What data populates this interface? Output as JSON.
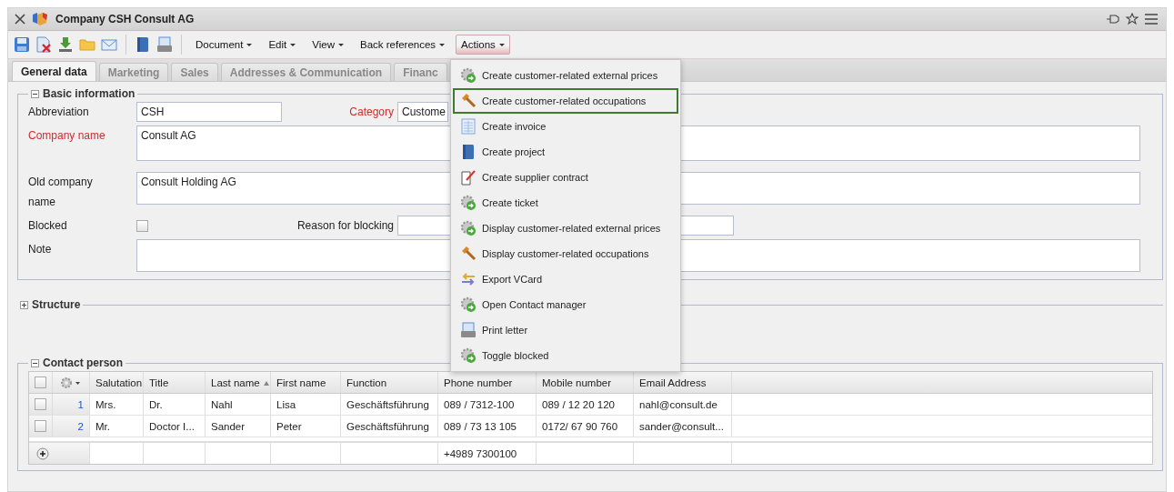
{
  "window": {
    "title": "Company CSH Consult AG"
  },
  "toolbar": {
    "menus": [
      {
        "label": "Document",
        "selected": false
      },
      {
        "label": "Edit",
        "selected": false
      },
      {
        "label": "View",
        "selected": false
      },
      {
        "label": "Back references",
        "selected": false
      },
      {
        "label": "Actions",
        "selected": true
      }
    ]
  },
  "tabs": [
    {
      "label": "General data",
      "selected": true
    },
    {
      "label": "Marketing",
      "selected": false
    },
    {
      "label": "Sales",
      "selected": false
    },
    {
      "label": "Addresses & Communication",
      "selected": false
    },
    {
      "label": "Financ",
      "selected": false
    }
  ],
  "basic_information": {
    "title": "Basic information",
    "expanded": true,
    "abbreviation": {
      "label": "Abbreviation",
      "required": false,
      "value": "CSH"
    },
    "category": {
      "label": "Category",
      "required": true,
      "value": "Custome"
    },
    "company_name": {
      "label": "Company name",
      "required": true,
      "value": "Consult AG"
    },
    "old_company_name": {
      "label": "Old company name",
      "required": false,
      "value": "Consult Holding AG"
    },
    "blocked": {
      "label": "Blocked",
      "checked": false
    },
    "reason_for_blocking": {
      "label": "Reason for blocking"
    },
    "note": {
      "label": "Note",
      "required": false
    }
  },
  "structure": {
    "title": "Structure",
    "expanded": false
  },
  "contact_person": {
    "title": "Contact person",
    "expanded": true,
    "columns": [
      "Salutation",
      "Title",
      "Last name",
      "First name",
      "Function",
      "Phone number",
      "Mobile number",
      "Email Address"
    ],
    "rows": [
      {
        "checked": false,
        "number": "1",
        "cells": [
          "Mrs.",
          "Dr.",
          "Nahl",
          "Lisa",
          "Geschäftsführung",
          "089 / 7312-100",
          "089 / 12 20 120",
          "nahl@consult.de"
        ]
      },
      {
        "checked": false,
        "number": "2",
        "cells": [
          "Mr.",
          "Doctor I...",
          "Sander",
          "Peter",
          "Geschäftsführung",
          "089 / 73 13 105",
          "0172/ 67 90 760",
          "sander@consult..."
        ]
      }
    ],
    "all_checked": false,
    "footer": {
      "phone_number": "+4989 7300100"
    }
  },
  "actions_menu": {
    "items": [
      {
        "label": "Create customer-related external prices",
        "selected": false
      },
      {
        "label": "Create customer-related occupations",
        "selected": true
      },
      {
        "label": "Create invoice",
        "selected": false
      },
      {
        "label": "Create project",
        "selected": false
      },
      {
        "label": "Create supplier contract",
        "selected": false
      },
      {
        "label": "Create ticket",
        "selected": false
      },
      {
        "label": "Display customer-related external prices",
        "selected": false
      },
      {
        "label": "Display customer-related occupations",
        "selected": false
      },
      {
        "label": "Export VCard",
        "selected": false
      },
      {
        "label": "Open Contact manager",
        "selected": false
      },
      {
        "label": "Print letter",
        "selected": false
      },
      {
        "label": "Toggle blocked",
        "selected": false
      }
    ]
  }
}
